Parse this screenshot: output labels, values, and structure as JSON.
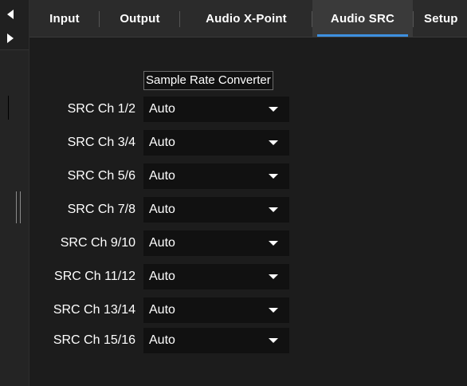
{
  "tabs": [
    {
      "label": "Input",
      "active": false
    },
    {
      "label": "Output",
      "active": false
    },
    {
      "label": "Audio X-Point",
      "active": false
    },
    {
      "label": "Audio SRC",
      "active": true
    },
    {
      "label": "Setup",
      "active": false
    }
  ],
  "section": {
    "title": "Sample Rate Converter"
  },
  "src_rows": [
    {
      "label": "SRC Ch 1/2",
      "value": "Auto"
    },
    {
      "label": "SRC Ch 3/4",
      "value": "Auto"
    },
    {
      "label": "SRC Ch 5/6",
      "value": "Auto"
    },
    {
      "label": "SRC Ch 7/8",
      "value": "Auto"
    },
    {
      "label": "SRC Ch 9/10",
      "value": "Auto"
    },
    {
      "label": "SRC Ch 11/12",
      "value": "Auto"
    },
    {
      "label": "SRC Ch 13/14",
      "value": "Auto"
    },
    {
      "label": "SRC Ch 15/16",
      "value": "Auto"
    }
  ],
  "colors": {
    "accent": "#3d8fe0",
    "background": "#1c1c1c",
    "tabbar": "#2b2b2b",
    "field": "#111111"
  },
  "icons": {
    "collapse_left": "triangle-left-icon",
    "expand_right": "triangle-right-icon",
    "splitter": "drag-grip-icon",
    "dropdown": "caret-down-icon"
  }
}
